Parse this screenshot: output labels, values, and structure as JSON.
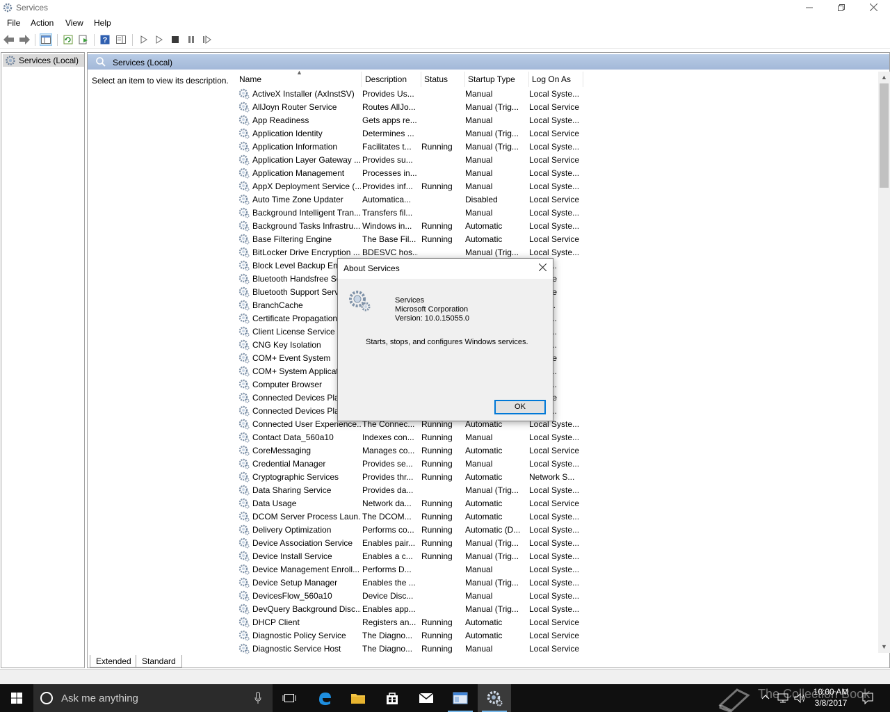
{
  "window": {
    "title": "Services",
    "min_icon": "minimize-icon",
    "max_icon": "restore-icon",
    "close_icon": "close-icon"
  },
  "menu": [
    "File",
    "Action",
    "View",
    "Help"
  ],
  "tree": {
    "item": "Services (Local)"
  },
  "panel": {
    "header": "Services (Local)",
    "hint": "Select an item to view its description."
  },
  "columns": [
    "Name",
    "Description",
    "Status",
    "Startup Type",
    "Log On As"
  ],
  "services": [
    [
      "ActiveX Installer (AxInstSV)",
      "Provides Us...",
      "",
      "Manual",
      "Local Syste..."
    ],
    [
      "AllJoyn Router Service",
      "Routes AllJo...",
      "",
      "Manual (Trig...",
      "Local Service"
    ],
    [
      "App Readiness",
      "Gets apps re...",
      "",
      "Manual",
      "Local Syste..."
    ],
    [
      "Application Identity",
      "Determines ...",
      "",
      "Manual (Trig...",
      "Local Service"
    ],
    [
      "Application Information",
      "Facilitates t...",
      "Running",
      "Manual (Trig...",
      "Local Syste..."
    ],
    [
      "Application Layer Gateway ...",
      "Provides su...",
      "",
      "Manual",
      "Local Service"
    ],
    [
      "Application Management",
      "Processes in...",
      "",
      "Manual",
      "Local Syste..."
    ],
    [
      "AppX Deployment Service (...",
      "Provides inf...",
      "Running",
      "Manual",
      "Local Syste..."
    ],
    [
      "Auto Time Zone Updater",
      "Automatica...",
      "",
      "Disabled",
      "Local Service"
    ],
    [
      "Background Intelligent Tran...",
      "Transfers fil...",
      "",
      "Manual",
      "Local Syste..."
    ],
    [
      "Background Tasks Infrastru...",
      "Windows in...",
      "Running",
      "Automatic",
      "Local Syste..."
    ],
    [
      "Base Filtering Engine",
      "The Base Fil...",
      "Running",
      "Automatic",
      "Local Service"
    ],
    [
      "BitLocker Drive Encryption ...",
      "BDESVC hos...",
      "",
      "Manual (Trig...",
      "Local Syste..."
    ],
    [
      "Block Level Backup Eng",
      "",
      "",
      "",
      "Syste..."
    ],
    [
      "Bluetooth Handsfree Se",
      "",
      "",
      "",
      "Service"
    ],
    [
      "Bluetooth Support Servi",
      "",
      "",
      "",
      "Service"
    ],
    [
      "BranchCache",
      "",
      "",
      "",
      "ork S..."
    ],
    [
      "Certificate Propagation",
      "",
      "",
      "",
      "Syste..."
    ],
    [
      "Client License Service (C",
      "",
      "",
      "",
      "Syste..."
    ],
    [
      "CNG Key Isolation",
      "",
      "",
      "",
      "Syste..."
    ],
    [
      "COM+ Event System",
      "",
      "",
      "",
      "Service"
    ],
    [
      "COM+ System Applicati",
      "",
      "",
      "",
      "Syste..."
    ],
    [
      "Computer Browser",
      "",
      "",
      "",
      "Syste..."
    ],
    [
      "Connected Devices Platf",
      "",
      "",
      "",
      "Service"
    ],
    [
      "Connected Devices Platf",
      "",
      "",
      "",
      "Syste..."
    ],
    [
      "Connected User Experience...",
      "The Connec...",
      "Running",
      "Automatic",
      "Local Syste..."
    ],
    [
      "Contact Data_560a10",
      "Indexes con...",
      "Running",
      "Manual",
      "Local Syste..."
    ],
    [
      "CoreMessaging",
      "Manages co...",
      "Running",
      "Automatic",
      "Local Service"
    ],
    [
      "Credential Manager",
      "Provides se...",
      "Running",
      "Manual",
      "Local Syste..."
    ],
    [
      "Cryptographic Services",
      "Provides thr...",
      "Running",
      "Automatic",
      "Network S..."
    ],
    [
      "Data Sharing Service",
      "Provides da...",
      "",
      "Manual (Trig...",
      "Local Syste..."
    ],
    [
      "Data Usage",
      "Network da...",
      "Running",
      "Automatic",
      "Local Service"
    ],
    [
      "DCOM Server Process Laun...",
      "The DCOM...",
      "Running",
      "Automatic",
      "Local Syste..."
    ],
    [
      "Delivery Optimization",
      "Performs co...",
      "Running",
      "Automatic (D...",
      "Local Syste..."
    ],
    [
      "Device Association Service",
      "Enables pair...",
      "Running",
      "Manual (Trig...",
      "Local Syste..."
    ],
    [
      "Device Install Service",
      "Enables a c...",
      "Running",
      "Manual (Trig...",
      "Local Syste..."
    ],
    [
      "Device Management Enroll...",
      "Performs D...",
      "",
      "Manual",
      "Local Syste..."
    ],
    [
      "Device Setup Manager",
      "Enables the ...",
      "",
      "Manual (Trig...",
      "Local Syste..."
    ],
    [
      "DevicesFlow_560a10",
      "Device Disc...",
      "",
      "Manual",
      "Local Syste..."
    ],
    [
      "DevQuery Background Disc...",
      "Enables app...",
      "",
      "Manual (Trig...",
      "Local Syste..."
    ],
    [
      "DHCP Client",
      "Registers an...",
      "Running",
      "Automatic",
      "Local Service"
    ],
    [
      "Diagnostic Policy Service",
      "The Diagno...",
      "Running",
      "Automatic",
      "Local Service"
    ],
    [
      "Diagnostic Service Host",
      "The Diagno...",
      "Running",
      "Manual",
      "Local Service"
    ]
  ],
  "tabs": [
    "Extended",
    "Standard"
  ],
  "dialog": {
    "title": "About Services",
    "product": "Services",
    "company": "Microsoft Corporation",
    "version": "Version: 10.0.15055.0",
    "message": "Starts, stops, and configures Windows services.",
    "ok": "OK"
  },
  "taskbar": {
    "search_placeholder": "Ask me anything",
    "time": "10:00 AM",
    "date": "3/8/2017",
    "watermark": "The Collection Book"
  },
  "colors": {
    "accent": "#0078d7",
    "panel_header": "#b9cce6",
    "taskbar": "#101010"
  }
}
